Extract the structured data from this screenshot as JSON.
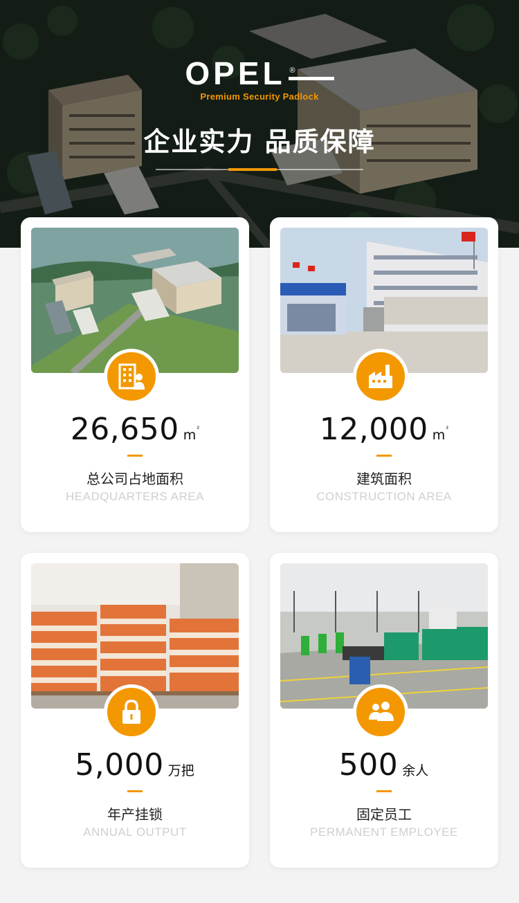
{
  "brand": {
    "name": "OPEL",
    "registered_mark": "®",
    "tagline": "Premium Security Padlock"
  },
  "hero": {
    "title": "企业实力 品质保障"
  },
  "colors": {
    "accent": "#f39800",
    "card_bg": "#ffffff",
    "page_bg": "#f3f3f3",
    "label_en": "#cfcfcf"
  },
  "stats": [
    {
      "icon": "office-building-icon",
      "value": "26,650",
      "unit": "m",
      "unit_sup": "²",
      "label_cn": "总公司占地面积",
      "label_en": "HEADQUARTERS AREA"
    },
    {
      "icon": "factory-icon",
      "value": "12,000",
      "unit": "m",
      "unit_sup": "²",
      "label_cn": "建筑面积",
      "label_en": "CONSTRUCTION AREA"
    },
    {
      "icon": "padlock-icon",
      "value": "5,000",
      "unit": "万把",
      "unit_sup": "",
      "label_cn": "年产挂锁",
      "label_en": "ANNUAL OUTPUT"
    },
    {
      "icon": "people-icon",
      "value": "500",
      "unit": "余人",
      "unit_sup": "",
      "label_cn": "固定员工",
      "label_en": "PERMANENT EMPLOYEE"
    }
  ]
}
